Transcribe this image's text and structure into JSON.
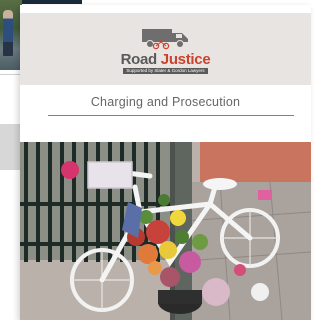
{
  "logo": {
    "name_part1": "Road",
    "name_part2": "Justice",
    "tagline": "Supported by Slater & Gordon Lawyers",
    "colors": {
      "grey": "#5a5a5a",
      "red": "#c9432e"
    }
  },
  "card": {
    "section_title": "Charging and Prosecution",
    "accent_color": "#d9633f",
    "header_bg": "#e8e4e1"
  },
  "photo": {
    "subject": "ghost-bike-memorial"
  },
  "icons": [
    "truck-icon"
  ]
}
